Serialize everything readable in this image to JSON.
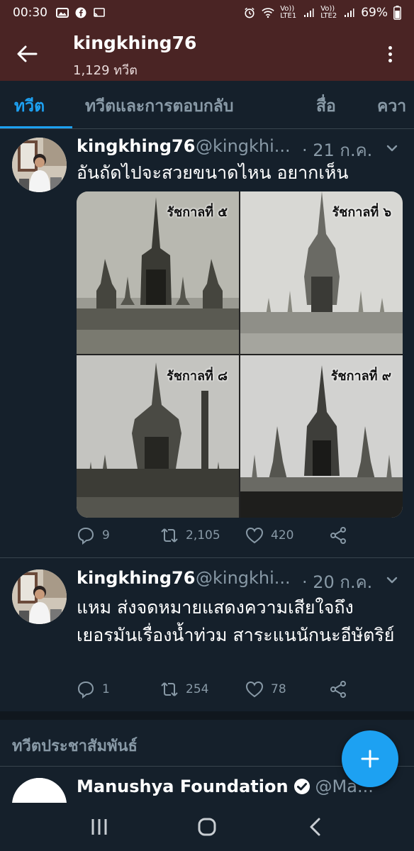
{
  "status_bar": {
    "time": "00:30",
    "battery": "69%",
    "sim1": "LTE1",
    "sim2": "LTE2"
  },
  "header": {
    "title": "kingkhing76",
    "subtitle": "1,129 ทวีต"
  },
  "tabs": [
    {
      "label": "ทวีต",
      "active": true
    },
    {
      "label": "ทวีตและการตอบกลับ",
      "active": false
    },
    {
      "label": "สื่อ",
      "active": false
    },
    {
      "label": "ควา",
      "active": false
    }
  ],
  "tweets": [
    {
      "name": "kingkhing76",
      "handle": "@kingkhi...",
      "date": "· 21 ก.ค.",
      "text": "อันถัดไปจะสวยขนาดไหน อยากเห็น",
      "photos": [
        {
          "label": "รัชกาลที่ ๕"
        },
        {
          "label": "รัชกาลที่ ๖"
        },
        {
          "label": "รัชกาลที่ ๘"
        },
        {
          "label": "รัชกาลที่ ๙"
        }
      ],
      "replies": "9",
      "retweets": "2,105",
      "likes": "420"
    },
    {
      "name": "kingkhing76",
      "handle": "@kingkhi...",
      "date": "· 20 ก.ค.",
      "text": "แหม ส่งจดหมายแสดงความเสียใจถึงเยอรมันเรื่องน้ำท่วม สาระแนนักนะอีษัตริย์",
      "replies": "1",
      "retweets": "254",
      "likes": "78"
    }
  ],
  "related": {
    "title": "ทวีตประชาสัมพันธ์",
    "name": "Manushya Foundation",
    "handle": "@Ma..."
  },
  "colors": {
    "accent": "#1da1f2",
    "header_bg": "#4a2424",
    "background": "#15202b",
    "muted": "#8899a6"
  },
  "icons": [
    "back-arrow-icon",
    "more-vertical-icon",
    "reply-icon",
    "retweet-icon",
    "like-icon",
    "share-icon",
    "chevron-down-icon",
    "verified-icon",
    "plus-icon",
    "recents-icon",
    "home-icon",
    "back-nav-icon"
  ]
}
